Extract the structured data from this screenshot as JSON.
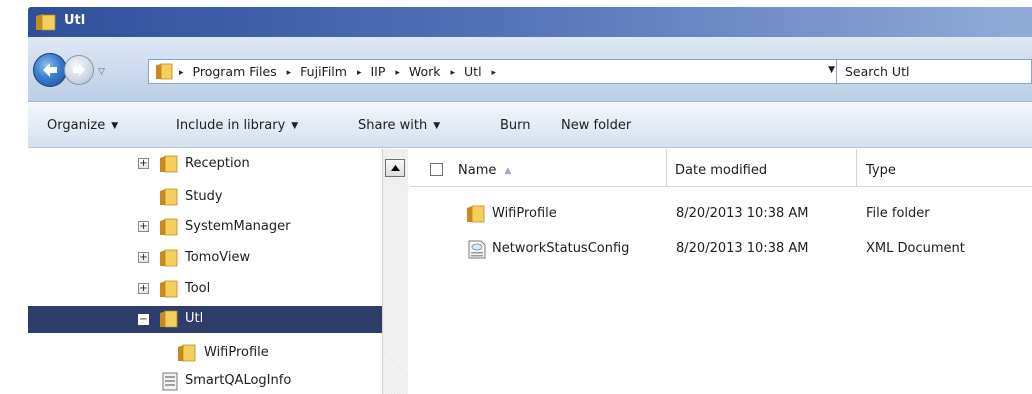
{
  "window": {
    "title": "Utl"
  },
  "address": {
    "crumbs": [
      "Program Files",
      "FujiFilm",
      "IIP",
      "Work",
      "Utl"
    ]
  },
  "search": {
    "placeholder": "Search Utl"
  },
  "toolbar": {
    "organize_label": "Organize",
    "include_label": "Include in library",
    "share_label": "Share with",
    "burn_label": "Burn",
    "new_folder_label": "New folder"
  },
  "tree": {
    "items": [
      {
        "label": "Reception",
        "expander": "+",
        "icon": "folder-icon"
      },
      {
        "label": "Study",
        "expander": "",
        "icon": "folder-icon"
      },
      {
        "label": "SystemManager",
        "expander": "+",
        "icon": "folder-icon"
      },
      {
        "label": "TomoView",
        "expander": "+",
        "icon": "folder-icon"
      },
      {
        "label": "Tool",
        "expander": "+",
        "icon": "folder-icon"
      },
      {
        "label": "Utl",
        "expander": "−",
        "icon": "folder-icon",
        "selected": true
      },
      {
        "label": "WifiProfile",
        "expander": "",
        "icon": "folder-icon"
      },
      {
        "label": "SmartQALogInfo",
        "expander": "",
        "icon": "file-icon"
      }
    ]
  },
  "columns": {
    "name": "Name",
    "date": "Date modified",
    "type": "Type"
  },
  "files": [
    {
      "name": "WifiProfile",
      "date": "8/20/2013 10:38 AM",
      "type": "File folder",
      "icon": "folder-icon"
    },
    {
      "name": "NetworkStatusConfig",
      "date": "8/20/2013 10:38 AM",
      "type": "XML Document",
      "icon": "xml-document-icon"
    }
  ],
  "colors": {
    "selection": "#2e3e6b",
    "titlebar_start": "#2e4f9a",
    "folder": "#e8b83a"
  }
}
